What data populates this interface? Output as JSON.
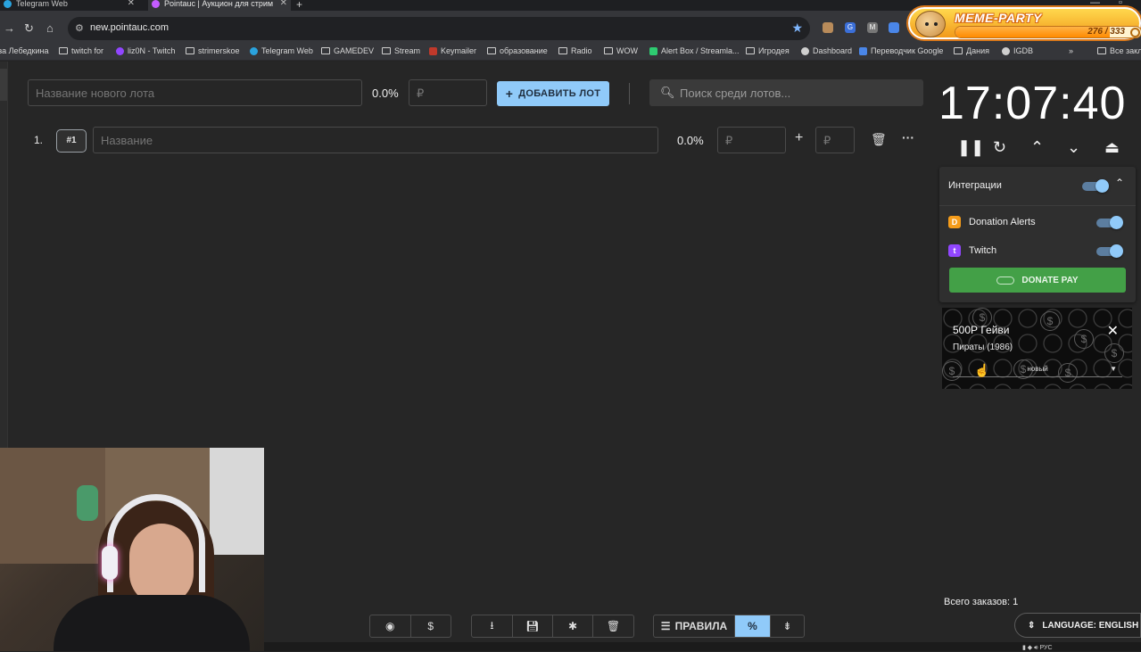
{
  "browser": {
    "tabs": [
      {
        "label": "Telegram Web"
      },
      {
        "label": "Pointauc | Аукцион для стрим"
      }
    ],
    "url": "new.pointauc.com",
    "bookmarks": [
      "за Лебедкина",
      "twitch for",
      "liz0N - Twitch",
      "strimerskoe",
      "Telegram Web",
      "GAMEDEV",
      "Stream",
      "Keymailer",
      "образование",
      "Radio",
      "WOW",
      "Alert Box / Streamla...",
      "Игродея",
      "Dashboard",
      "Переводчик Google",
      "Дания",
      "IGDB",
      "Все закл"
    ]
  },
  "overlay": {
    "title": "MEME-PARTY",
    "progress": "276 / 333",
    "progress_fraction": 0.83
  },
  "toolbar": {
    "new_lot_placeholder": "Название нового лота",
    "new_lot_percent": "0.0%",
    "amount_placeholder": "₽",
    "add_button": "ДОБАВИТЬ ЛОТ",
    "search_placeholder": "Поиск среди лотов..."
  },
  "lots": [
    {
      "index": "1.",
      "id": "#1",
      "name_placeholder": "Название",
      "percent": "0.0%",
      "amount_placeholder": "₽",
      "add_placeholder": "₽"
    }
  ],
  "timer": {
    "time": "17:07:40"
  },
  "integrations": {
    "title": "Интеграции",
    "items": [
      {
        "name": "Donation Alerts",
        "logo": "D",
        "color": "#f59c1a"
      },
      {
        "name": "Twitch",
        "logo": "t",
        "color": "#9146ff"
      }
    ],
    "donate_pay": "DONATE PAY"
  },
  "alert": {
    "title": "500Р Гейви",
    "subtitle": "Пираты (1986)",
    "status": "новый"
  },
  "footer": {
    "rules": "ПРАВИЛА",
    "orders": "Всего заказов: 1",
    "language": "LANGUAGE: ENGLISH"
  }
}
